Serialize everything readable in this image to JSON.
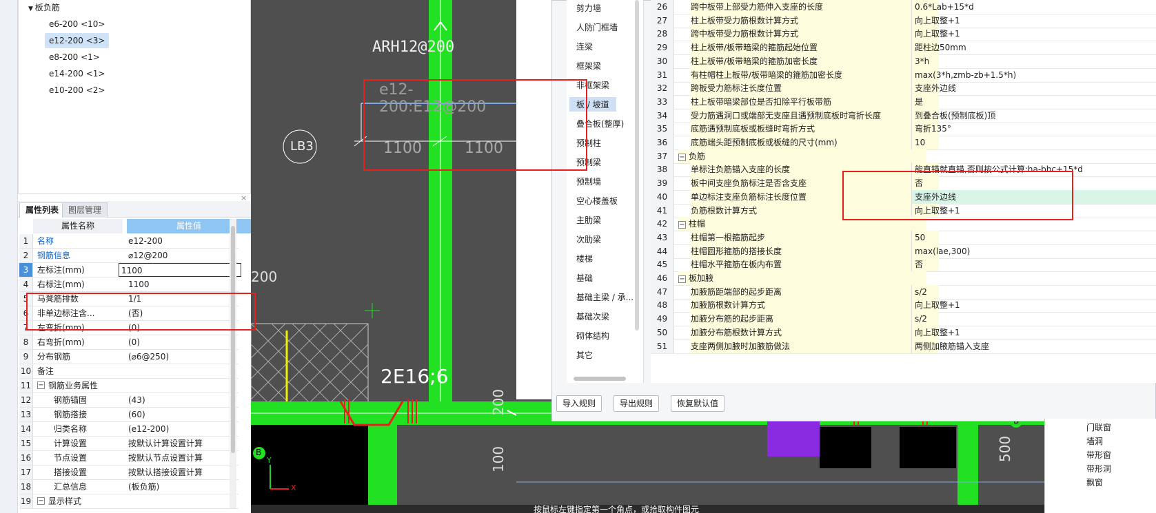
{
  "tree": {
    "parent": "板负筋",
    "items": [
      {
        "label": "e6-200 <10>"
      },
      {
        "label": "e12-200 <3>",
        "selected": true
      },
      {
        "label": "e8-200 <1>"
      },
      {
        "label": "e14-200 <1>"
      },
      {
        "label": "e10-200 <2>"
      }
    ]
  },
  "tabs": {
    "attr": "属性列表",
    "layer": "图层管理"
  },
  "props": {
    "head_name": "属性名称",
    "head_value": "属性值",
    "rows": [
      {
        "n": "1",
        "k": "名称",
        "v": "e12-200",
        "blue": true
      },
      {
        "n": "2",
        "k": "钢筋信息",
        "v": "⌀12@200",
        "blue": true
      },
      {
        "n": "3",
        "k": "左标注(mm)",
        "v": "1100",
        "edit": true
      },
      {
        "n": "4",
        "k": "右标注(mm)",
        "v": "1100"
      },
      {
        "n": "5",
        "k": "马凳筋排数",
        "v": "1/1"
      },
      {
        "n": "6",
        "k": "非单边标注含...",
        "v": "(否)"
      },
      {
        "n": "7",
        "k": "左弯折(mm)",
        "v": "(0)"
      },
      {
        "n": "8",
        "k": "右弯折(mm)",
        "v": "(0)"
      },
      {
        "n": "9",
        "k": "分布钢筋",
        "v": "(⌀6@250)"
      },
      {
        "n": "10",
        "k": "备注",
        "v": ""
      },
      {
        "n": "11",
        "k": "钢筋业务属性",
        "v": "",
        "group": true
      },
      {
        "n": "12",
        "k": "钢筋锚固",
        "v": "(43)",
        "indent": true
      },
      {
        "n": "13",
        "k": "钢筋搭接",
        "v": "(60)",
        "indent": true
      },
      {
        "n": "14",
        "k": "归类名称",
        "v": "(e12-200)",
        "indent": true
      },
      {
        "n": "15",
        "k": "计算设置",
        "v": "按默认计算设置计算",
        "indent": true
      },
      {
        "n": "16",
        "k": "节点设置",
        "v": "按默认节点设置计算",
        "indent": true
      },
      {
        "n": "17",
        "k": "搭接设置",
        "v": "按默认搭接设置计算",
        "indent": true
      },
      {
        "n": "18",
        "k": "汇总信息",
        "v": "(板负筋)",
        "indent": true
      },
      {
        "n": "19",
        "k": "显示样式",
        "v": "",
        "group": true
      }
    ]
  },
  "cad": {
    "label_arh": "ARH12@200",
    "label_rebar": "e12-200:E12@200",
    "dim_left": "1100",
    "dim_right": "1100",
    "circle": "LB3",
    "label_200": "200",
    "label_2e": "2E16;6",
    "dim_200b": "200",
    "dim_100": "100",
    "dim_500": "500",
    "axis_b": "B",
    "axis_y": "Y",
    "axis_x": "X",
    "status": "按鼠标左键指定第一个角点，或拾取构件图元"
  },
  "categories": {
    "items": [
      {
        "label": "剪力墙"
      },
      {
        "label": "人防门框墙"
      },
      {
        "label": "连梁"
      },
      {
        "label": "框架梁"
      },
      {
        "label": "非框架梁"
      },
      {
        "label": "板 / 坡道",
        "selected": true
      },
      {
        "label": "叠合板(整厚)"
      },
      {
        "label": "预制柱"
      },
      {
        "label": "预制梁"
      },
      {
        "label": "预制墙"
      },
      {
        "label": "空心楼盖板"
      },
      {
        "label": "主肋梁"
      },
      {
        "label": "次肋梁"
      },
      {
        "label": "楼梯"
      },
      {
        "label": "基础"
      },
      {
        "label": "基础主梁 / 承..."
      },
      {
        "label": "基础次梁"
      },
      {
        "label": "砌体结构"
      },
      {
        "label": "其它"
      }
    ]
  },
  "settings": {
    "rows": [
      {
        "n": "26",
        "k": "跨中板带上部受力筋伸入支座的长度",
        "v": "0.6*Lab+15*d"
      },
      {
        "n": "27",
        "k": "柱上板带受力筋根数计算方式",
        "v": "向上取整+1"
      },
      {
        "n": "28",
        "k": "跨中板带受力筋根数计算方式",
        "v": "向上取整+1"
      },
      {
        "n": "29",
        "k": "柱上板带/板带暗梁的箍筋起始位置",
        "v": "距柱边50mm"
      },
      {
        "n": "30",
        "k": "柱上板带/板带暗梁的箍筋加密长度",
        "v": "3*h"
      },
      {
        "n": "31",
        "k": "有柱帽柱上板带/板带暗梁的箍筋加密长度",
        "v": "max(3*h,zmb-zb+1.5*h)"
      },
      {
        "n": "32",
        "k": "跨板受力筋标注长度位置",
        "v": "支座外边线"
      },
      {
        "n": "33",
        "k": "柱上板带暗梁部位是否扣除平行板带筋",
        "v": "是"
      },
      {
        "n": "34",
        "k": "受力筋遇洞口或端部无支座且遇预制底板时弯折长度",
        "v": "到叠合板(预制底板)顶"
      },
      {
        "n": "35",
        "k": "底筋遇预制底板或板缝时弯折方式",
        "v": "弯折135°"
      },
      {
        "n": "36",
        "k": "底筋端头距预制底板或板缝的尺寸(mm)",
        "v": "10"
      },
      {
        "n": "37",
        "k": "负筋",
        "v": "",
        "group": true
      },
      {
        "n": "38",
        "k": "单标注负筋锚入支座的长度",
        "v": "能直锚就直锚,否则按公式计算:ha-bhc+15*d"
      },
      {
        "n": "39",
        "k": "板中间支座负筋标注是否含支座",
        "v": "否"
      },
      {
        "n": "40",
        "k": "单边标注支座负筋标注长度位置",
        "v": "支座外边线",
        "hl": true
      },
      {
        "n": "41",
        "k": "负筋根数计算方式",
        "v": "向上取整+1"
      },
      {
        "n": "42",
        "k": "柱帽",
        "v": "",
        "group": true
      },
      {
        "n": "43",
        "k": "柱帽第一根箍筋起步",
        "v": "50"
      },
      {
        "n": "44",
        "k": "柱帽圆形箍筋的搭接长度",
        "v": "max(lae,300)"
      },
      {
        "n": "45",
        "k": "柱帽水平箍筋在板内布置",
        "v": "否"
      },
      {
        "n": "46",
        "k": "板加腋",
        "v": "",
        "group": true
      },
      {
        "n": "47",
        "k": "加腋筋距端部的起步距离",
        "v": "s/2"
      },
      {
        "n": "48",
        "k": "加腋筋根数计算方式",
        "v": "向上取整+1"
      },
      {
        "n": "49",
        "k": "加腋分布筋的起步距离",
        "v": "s/2"
      },
      {
        "n": "50",
        "k": "加腋分布筋根数计算方式",
        "v": "向上取整+1"
      },
      {
        "n": "51",
        "k": "支座两侧加腋时加腋筋做法",
        "v": "两侧加腋筋锚入支座"
      }
    ]
  },
  "buttons": {
    "import": "导入规则",
    "export": "导出规则",
    "restore": "恢复默认值"
  },
  "right_panel": {
    "items": [
      {
        "label": "门联窗"
      },
      {
        "label": "墙洞"
      },
      {
        "label": "带形窗"
      },
      {
        "label": "带形洞"
      },
      {
        "label": "飘窗"
      }
    ]
  }
}
